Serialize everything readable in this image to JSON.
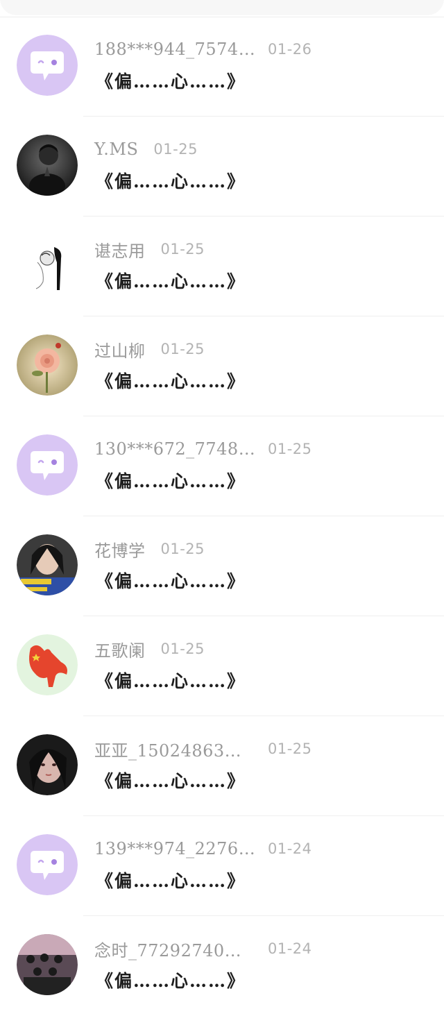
{
  "colors": {
    "avatar_default_bg": "#d9c6f4",
    "avatar_default_icon": "#ffffff",
    "name_text": "#9a9a9a",
    "date_text": "#b3b3b3",
    "message_text": "#1e1e1e",
    "separator": "#efefef"
  },
  "rows": [
    {
      "name": "188***944_7574…",
      "date": "01-26",
      "message": "《偏……心……》",
      "avatar": "default-chat-bubble-icon"
    },
    {
      "name": "Y.MS",
      "date": "01-25",
      "message": "《偏……心……》",
      "avatar": "photo-avatar"
    },
    {
      "name": "谌志用",
      "date": "01-25",
      "message": "《偏……心……》",
      "avatar": "photo-avatar"
    },
    {
      "name": "过山柳",
      "date": "01-25",
      "message": "《偏……心……》",
      "avatar": "photo-avatar"
    },
    {
      "name": "130***672_7748…",
      "date": "01-25",
      "message": "《偏……心……》",
      "avatar": "default-chat-bubble-icon"
    },
    {
      "name": "花博学",
      "date": "01-25",
      "message": "《偏……心……》",
      "avatar": "photo-avatar"
    },
    {
      "name": "五歌阑",
      "date": "01-25",
      "message": "《偏……心……》",
      "avatar": "photo-avatar"
    },
    {
      "name": "亚亚_15024863…",
      "date": "01-25",
      "message": "《偏……心……》",
      "avatar": "photo-avatar"
    },
    {
      "name": "139***974_2276…",
      "date": "01-24",
      "message": "《偏……心……》",
      "avatar": "default-chat-bubble-icon"
    },
    {
      "name": "念时_77292740…",
      "date": "01-24",
      "message": "《偏……心……》",
      "avatar": "photo-avatar"
    }
  ]
}
